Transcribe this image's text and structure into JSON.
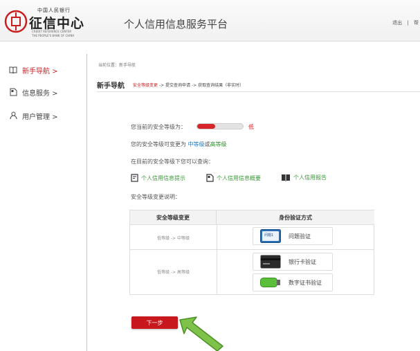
{
  "header": {
    "logo_small": "中国人民银行",
    "logo_big": "征信中心",
    "logo_en_line1": "CREDIT REFERENCE CENTER",
    "logo_en_line2": "THE PEOPLE'S BANK OF CHINA",
    "platform_title": "个人信用信息服务平台",
    "links": [
      "退出",
      "帮"
    ]
  },
  "sidebar": {
    "items": [
      {
        "label": "新手导航 >",
        "icon": "book-icon",
        "active": true
      },
      {
        "label": "信息服务 >",
        "icon": "document-icon",
        "active": false
      },
      {
        "label": "用户管理 >",
        "icon": "user-icon",
        "active": false
      }
    ]
  },
  "breadcrumb": "当前位置：新手导航",
  "guide": {
    "title": "新手导航",
    "step1": "安全等级变更",
    "sep1": " -> ",
    "step2": "提交查询申请",
    "sep2": " -> ",
    "step3": "获取查询结果（非实时）"
  },
  "security": {
    "current_label": "您当前的安全等级为：",
    "level": 0.4,
    "level_text": "低",
    "change_prefix": "您的安全等级可变更为",
    "mid_level": "中等级",
    "or_text": "或",
    "high_level": "高等级",
    "query_intro": "在目前的安全等级下您可以查询：",
    "links": [
      "个人信用信息提示",
      "个人信用信息概要",
      "个人信用报告"
    ],
    "desc_label": "安全等级变更说明："
  },
  "table": {
    "col1": "安全等级变更",
    "col2": "身份验证方式",
    "row1_change": "低等级 -> 中等级",
    "row1_method": "问题验证",
    "row1_icon_text": "问题1",
    "row2_change": "低等级 -> 高等级",
    "row2_method1": "银行卡验证",
    "row2_method2": "数字证书验证"
  },
  "next_button": "下一步",
  "colors": {
    "accent": "#c8171d",
    "link": "#3a9a3a",
    "mid": "#1a7ec6",
    "high": "#2f8f2f"
  }
}
